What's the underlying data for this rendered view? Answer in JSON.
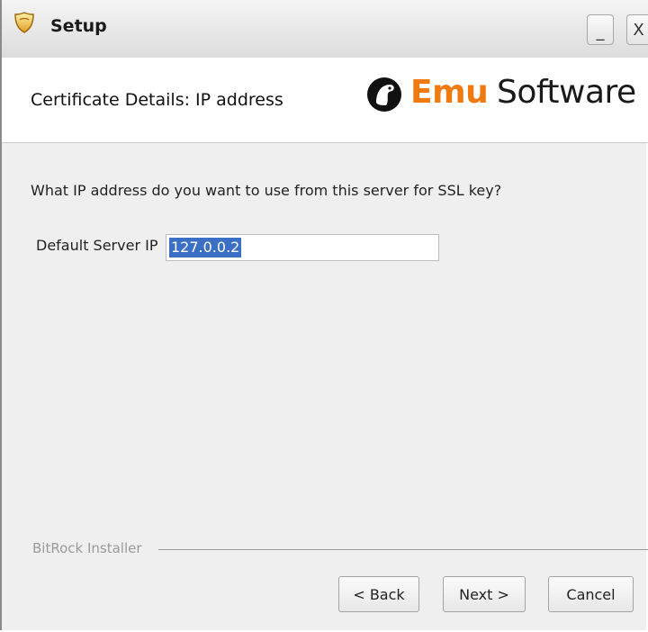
{
  "window": {
    "title": "Setup",
    "minimize_glyph": "_",
    "close_glyph": "X"
  },
  "header": {
    "title": "Certificate Details: IP address",
    "logo": {
      "part1": "Emu",
      "part2": "Software",
      "brand_color": "#f07a10"
    }
  },
  "main": {
    "question": "What IP address do you want to use from this server for SSL key?",
    "field": {
      "label": "Default Server IP",
      "value": "127.0.0.2"
    }
  },
  "footer": {
    "installer_label": "BitRock Installer",
    "back_label": "< Back",
    "next_label": "Next >",
    "cancel_label": "Cancel"
  },
  "icons": {
    "window_icon": "setup-shield-icon",
    "logo_mark": "emu-logo-icon"
  }
}
